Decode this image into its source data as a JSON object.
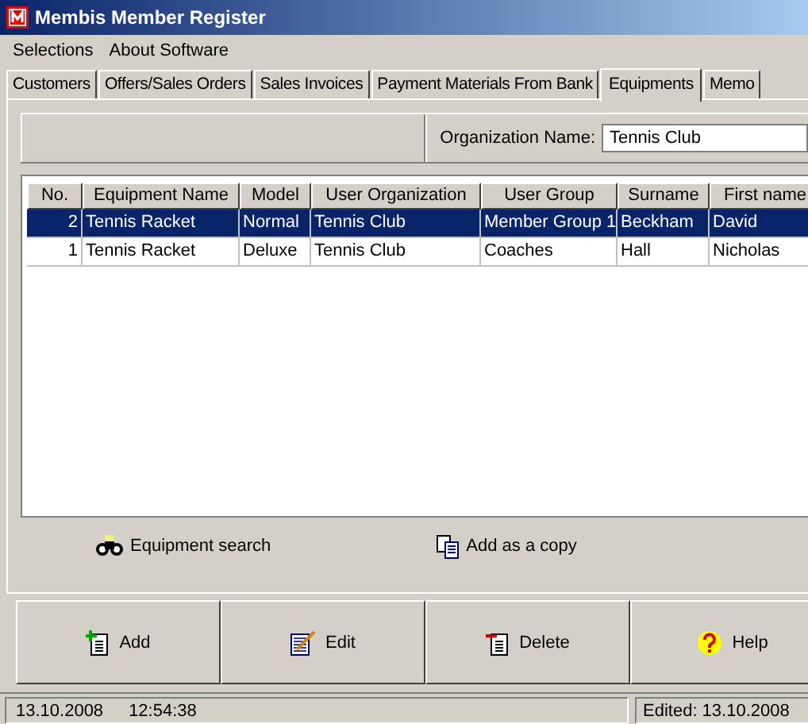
{
  "window": {
    "title": "Membis Member Register"
  },
  "menu": [
    "Selections",
    "About Software"
  ],
  "tabs": [
    {
      "label": "Customers",
      "selected": false
    },
    {
      "label": "Offers/Sales Orders",
      "selected": false
    },
    {
      "label": "Sales Invoices",
      "selected": false
    },
    {
      "label": "Payment Materials From Bank",
      "selected": false
    },
    {
      "label": "Equipments",
      "selected": true
    },
    {
      "label": "Memo",
      "selected": false
    }
  ],
  "filter": {
    "label": "Organization Name:",
    "value": "Tennis Club"
  },
  "table": {
    "columns": [
      "No.",
      "Equipment Name",
      "Model",
      "User Organization",
      "User Group",
      "Surname",
      "First name"
    ],
    "rows": [
      {
        "cells": [
          "2",
          "Tennis Racket",
          "Normal",
          "Tennis Club",
          "Member Group 1",
          "Beckham",
          "David"
        ],
        "selected": true
      },
      {
        "cells": [
          "1",
          "Tennis Racket",
          "Deluxe",
          "Tennis Club",
          "Coaches",
          "Hall",
          "Nicholas"
        ],
        "selected": false
      }
    ]
  },
  "actions": [
    {
      "kind": "search",
      "label": "Equipment search"
    },
    {
      "kind": "copy",
      "label": "Add as a copy"
    }
  ],
  "buttons": [
    {
      "kind": "add",
      "label": "Add"
    },
    {
      "kind": "edit",
      "label": "Edit"
    },
    {
      "kind": "delete",
      "label": "Delete"
    },
    {
      "kind": "help",
      "label": "Help"
    }
  ],
  "status_bar": {
    "date": "13.10.2008",
    "time": "12:54:38",
    "edited": "Edited: 13.10.2008"
  }
}
